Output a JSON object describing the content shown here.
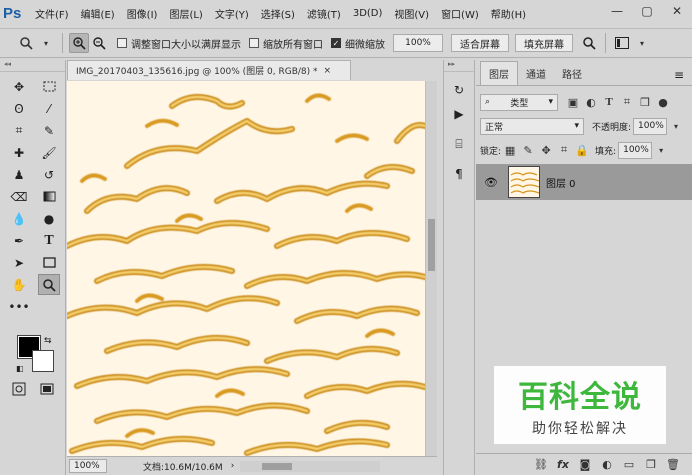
{
  "app": {
    "logo": "Ps",
    "menu": [
      "文件(F)",
      "编辑(E)",
      "图像(I)",
      "图层(L)",
      "文字(Y)",
      "选择(S)",
      "滤镜(T)",
      "3D(D)",
      "视图(V)",
      "窗口(W)",
      "帮助(H)"
    ],
    "window_controls": {
      "minimize": "—",
      "maximize": "▢",
      "close": "✕"
    }
  },
  "options": {
    "resize_windows": "调整窗口大小以满屏显示",
    "zoom_all": "缩放所有窗口",
    "scrubby_zoom": "细微缩放",
    "zoom_value": "100%",
    "fit_screen": "适合屏幕",
    "fill_screen": "填充屏幕"
  },
  "document": {
    "tab_title": "IMG_20170403_135616.jpg @ 100% (图层 0, RGB/8) *",
    "close": "×",
    "status_zoom": "100%",
    "status_info": "文档:10.6M/10.6M"
  },
  "layers": {
    "tabs": [
      "图层",
      "通道",
      "路径"
    ],
    "kind_filter": "类型",
    "blend_mode": "正常",
    "opacity_label": "不透明度:",
    "opacity_value": "100%",
    "lock_label": "锁定:",
    "fill_label": "填充:",
    "fill_value": "100%",
    "layer_name": "图层 0"
  },
  "watermark": {
    "main": "百科全说",
    "sub": "助你轻松解决"
  },
  "colors": {
    "foreground": "#000000",
    "background": "#ffffff",
    "canvas_bg": "#fff6e6",
    "stroke_dark": "#c98a12",
    "stroke_light": "#f5cf6a",
    "watermark_green": "#3db83d"
  }
}
